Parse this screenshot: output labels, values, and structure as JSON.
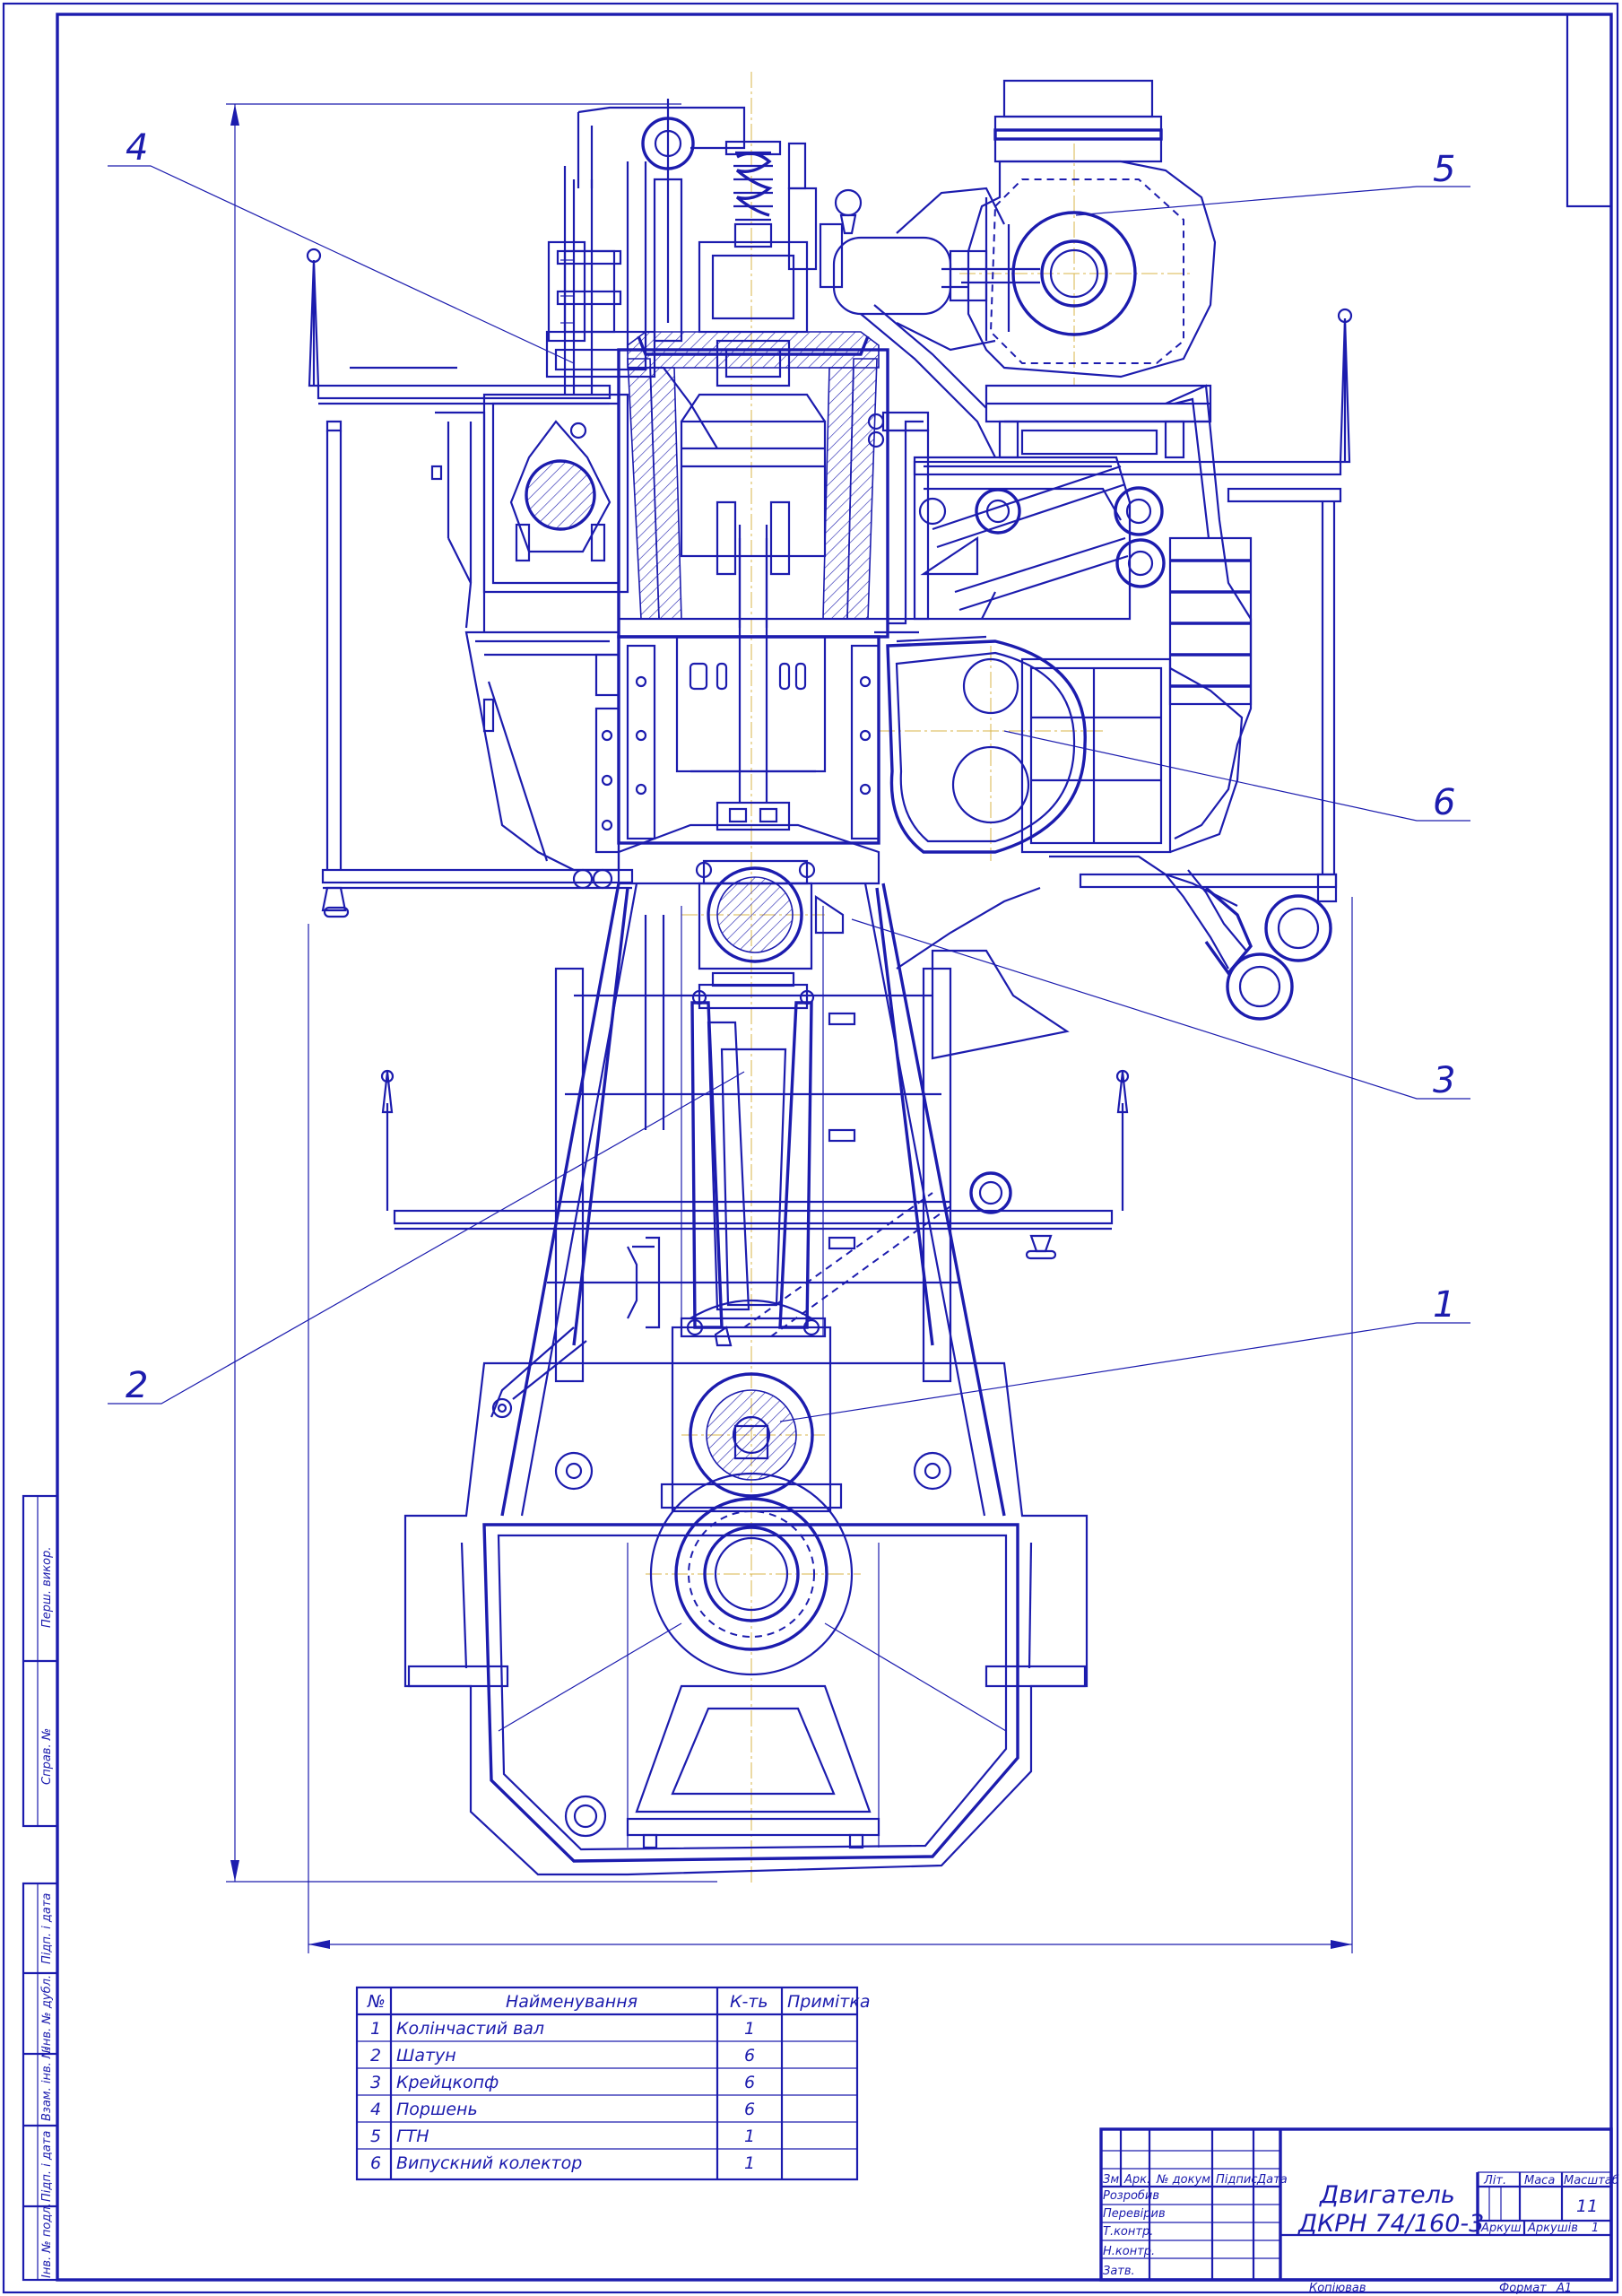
{
  "callouts": [
    {
      "label": "1"
    },
    {
      "label": "2"
    },
    {
      "label": "3"
    },
    {
      "label": "4"
    },
    {
      "label": "5"
    },
    {
      "label": "6"
    }
  ],
  "parts_table": {
    "headers": {
      "num": "№",
      "name": "Найменування",
      "qty": "К-ть",
      "note": "Примітка"
    },
    "rows": [
      {
        "num": "1",
        "name": "Колінчастий вал",
        "qty": "1",
        "note": ""
      },
      {
        "num": "2",
        "name": "Шатун",
        "qty": "6",
        "note": ""
      },
      {
        "num": "3",
        "name": "Крейцкопф",
        "qty": "6",
        "note": ""
      },
      {
        "num": "4",
        "name": "Поршень",
        "qty": "6",
        "note": ""
      },
      {
        "num": "5",
        "name": "ГТН",
        "qty": "1",
        "note": ""
      },
      {
        "num": "6",
        "name": "Випускний колектор",
        "qty": "1",
        "note": ""
      }
    ]
  },
  "title_block": {
    "title_line1": "Двигатель",
    "title_line2": "ДКРН 74/160-3",
    "col_labels": {
      "izm": "Зм",
      "arkush": "Арк.",
      "doc": "№ докум.",
      "sign": "Підпис",
      "date": "Дата"
    },
    "roles": [
      "Розробив",
      "Перевірив",
      "Т.контр.",
      "Н.контр.",
      "Затв."
    ],
    "lit": "Літ.",
    "mass": "Маса",
    "scale": "Масштаб",
    "scale_value": "11",
    "sheet": "Аркуш",
    "sheets": "Аркушів",
    "sheets_value": "1",
    "copied": "Копіював",
    "format": "Формат",
    "format_value": "A1"
  },
  "side_strip": [
    "Перш. викор.",
    "Справ. №",
    "Підп. і дата",
    "Інв. № дубл.",
    "Взам. інв. №",
    "Підп. і дата",
    "Інв. № подл."
  ]
}
